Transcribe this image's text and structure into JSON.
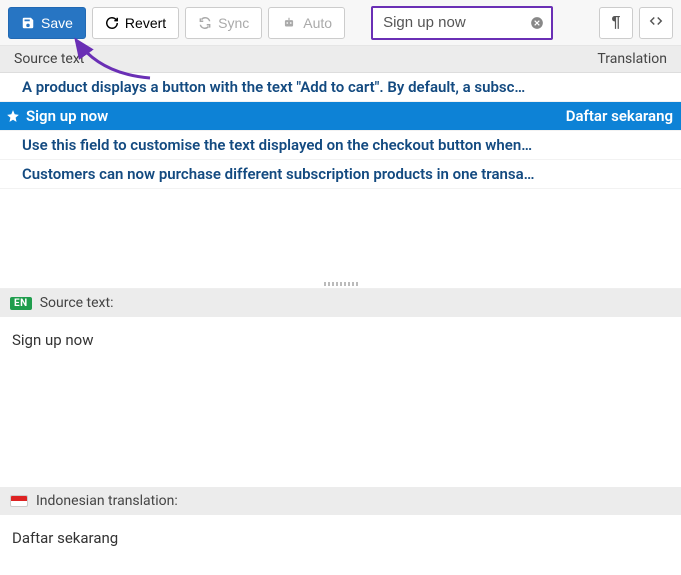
{
  "toolbar": {
    "save_label": "Save",
    "revert_label": "Revert",
    "sync_label": "Sync",
    "auto_label": "Auto"
  },
  "search": {
    "value": "Sign up now"
  },
  "columns": {
    "source": "Source text",
    "translation": "Translation"
  },
  "rows": [
    {
      "source": "A product displays a button with the text \"Add to cart\". By default, a subsc…",
      "translation": "",
      "selected": false
    },
    {
      "source": "Sign up now",
      "translation": "Daftar sekarang",
      "selected": true
    },
    {
      "source": "Use this field to customise the text displayed on the checkout button when…",
      "translation": "",
      "selected": false
    },
    {
      "source": "Customers can now purchase different subscription products in one transa…",
      "translation": "",
      "selected": false
    }
  ],
  "source_panel": {
    "badge": "EN",
    "label": "Source text:",
    "text": "Sign up now"
  },
  "translation_panel": {
    "label": "Indonesian translation:",
    "text": "Daftar sekarang"
  }
}
